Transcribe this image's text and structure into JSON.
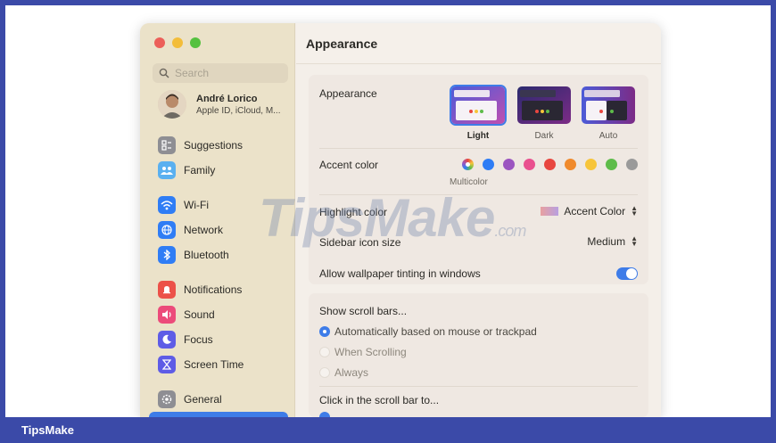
{
  "window": {
    "title": "Appearance"
  },
  "sidebar": {
    "search_placeholder": "Search",
    "profile": {
      "name": "André Lorico",
      "subtitle": "Apple ID, iCloud, M..."
    },
    "items": [
      {
        "label": "Suggestions",
        "icon": "suggestions-icon",
        "color": "#8e8e93"
      },
      {
        "label": "Family",
        "icon": "family-icon",
        "color": "#5ab0f0"
      },
      {
        "label": "Wi-Fi",
        "icon": "wifi-icon",
        "color": "#2f7df5"
      },
      {
        "label": "Network",
        "icon": "network-icon",
        "color": "#2f7df5"
      },
      {
        "label": "Bluetooth",
        "icon": "bluetooth-icon",
        "color": "#2f7df5"
      },
      {
        "label": "Notifications",
        "icon": "notifications-icon",
        "color": "#ec5148"
      },
      {
        "label": "Sound",
        "icon": "sound-icon",
        "color": "#ec4b7a"
      },
      {
        "label": "Focus",
        "icon": "focus-icon",
        "color": "#5e5ce6"
      },
      {
        "label": "Screen Time",
        "icon": "screen-time-icon",
        "color": "#5e5ce6"
      },
      {
        "label": "General",
        "icon": "gear-icon",
        "color": "#8e8e93"
      }
    ]
  },
  "appearance": {
    "label": "Appearance",
    "options": [
      {
        "label": "Light",
        "selected": true
      },
      {
        "label": "Dark",
        "selected": false
      },
      {
        "label": "Auto",
        "selected": false
      }
    ]
  },
  "accent": {
    "label": "Accent color",
    "selected_label": "Multicolor",
    "colors": [
      "multicolor",
      "#2f7df5",
      "#9b55c0",
      "#e9508f",
      "#e8463f",
      "#f08a2c",
      "#f7c53a",
      "#5ebc4a",
      "#9a9a9a"
    ]
  },
  "highlight": {
    "label": "Highlight color",
    "value": "Accent Color"
  },
  "sidebar_icon_size": {
    "label": "Sidebar icon size",
    "value": "Medium"
  },
  "wallpaper_tinting": {
    "label": "Allow wallpaper tinting in windows",
    "on": true
  },
  "scroll_bars": {
    "label": "Show scroll bars...",
    "options": [
      {
        "label": "Automatically based on mouse or trackpad",
        "selected": true
      },
      {
        "label": "When Scrolling",
        "selected": false
      },
      {
        "label": "Always",
        "selected": false
      }
    ]
  },
  "click_scroll": {
    "label": "Click in the scroll bar to..."
  },
  "watermark": {
    "text": "TipsMake",
    "suffix": ".com"
  },
  "footer": {
    "brand": "TipsMake"
  }
}
